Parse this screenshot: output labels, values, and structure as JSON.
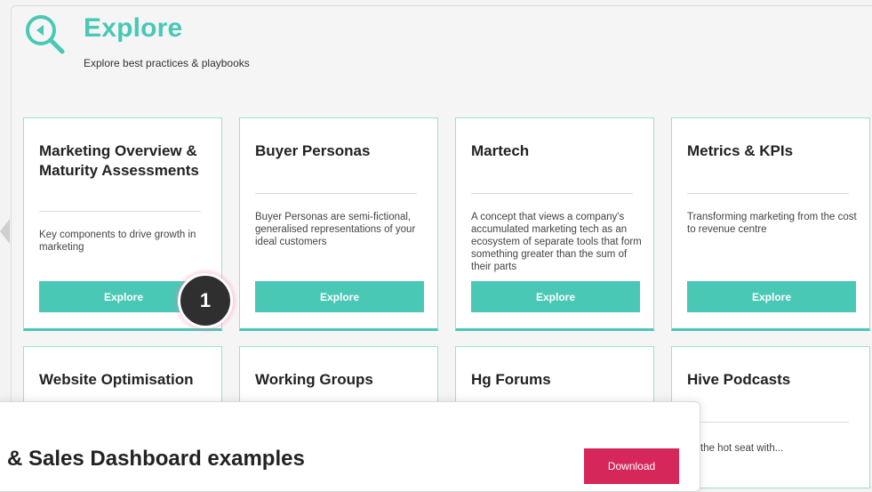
{
  "header": {
    "icon": "search-play-icon",
    "title": "Explore",
    "subtitle": "Explore best practices & playbooks"
  },
  "cards": [
    {
      "title": "Marketing Overview & Maturity Assessments",
      "description": "Key components to drive growth in marketing",
      "button": "Explore"
    },
    {
      "title": "Buyer Personas",
      "description": "Buyer Personas are semi-fictional, generalised representations of your ideal customers",
      "button": "Explore"
    },
    {
      "title": "Martech",
      "description": "A concept that views a company's accumulated marketing tech as an ecosystem of separate tools that form something greater than the sum of their parts",
      "button": "Explore"
    },
    {
      "title": "Metrics & KPIs",
      "description": "Transforming marketing from the cost to revenue centre",
      "button": "Explore"
    },
    {
      "title": "Website Optimisation"
    },
    {
      "title": "Working Groups"
    },
    {
      "title": "Hg Forums"
    },
    {
      "title": "Hive Podcasts",
      "description_partial": "the hot seat with..."
    }
  ],
  "step_badge": "1",
  "popup": {
    "title": "& Sales Dashboard examples",
    "download_label": "Download"
  },
  "colors": {
    "accent": "#49c8b6",
    "download": "#d6275a",
    "badge": "#2f2f2f"
  }
}
